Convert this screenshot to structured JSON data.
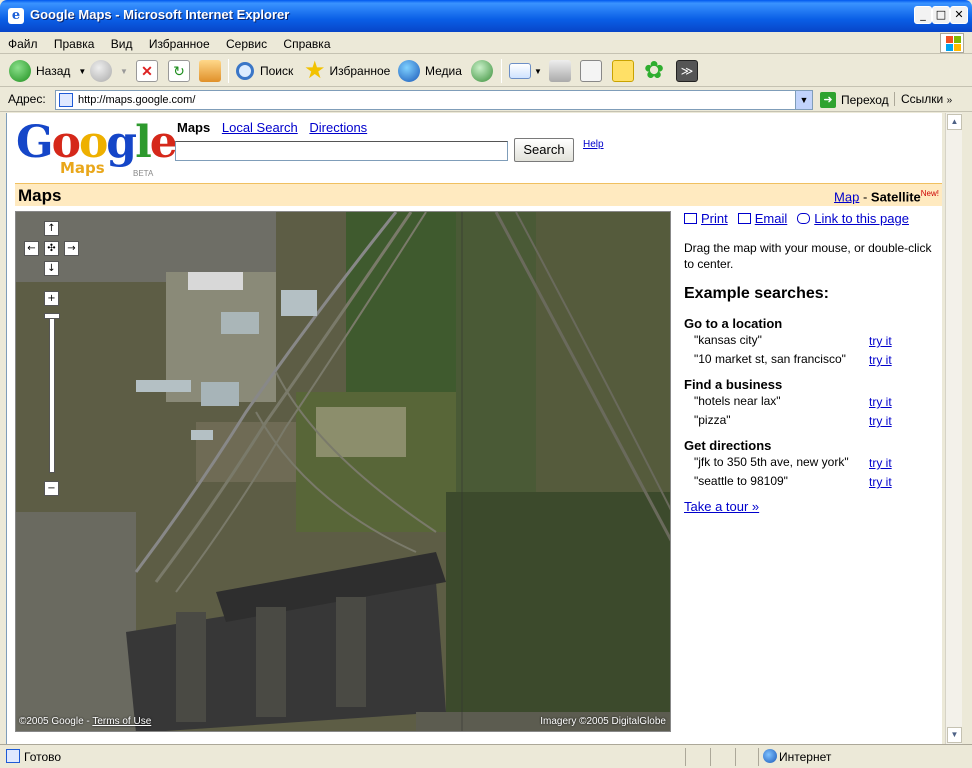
{
  "window": {
    "title": "Google Maps - Microsoft Internet Explorer"
  },
  "menu": [
    "Файл",
    "Правка",
    "Вид",
    "Избранное",
    "Сервис",
    "Справка"
  ],
  "toolbar": {
    "back": "Назад",
    "search": "Поиск",
    "favorites": "Избранное",
    "media": "Медиа"
  },
  "address": {
    "label": "Адрес:",
    "url": "http://maps.google.com/",
    "go": "Переход",
    "links": "Ссылки"
  },
  "google": {
    "logo": "Google",
    "logo_sub": "Maps",
    "logo_beta": "BETA",
    "nav": {
      "maps": "Maps",
      "local": "Local Search",
      "directions": "Directions"
    },
    "search_button": "Search",
    "help": "Help"
  },
  "mapsbar": {
    "title": "Maps",
    "map": "Map",
    "dash": " - ",
    "satellite": "Satellite",
    "new": "New!"
  },
  "map": {
    "copyright": "©2005 Google - ",
    "terms": "Terms of Use",
    "imagery": "Imagery ©2005 DigitalGlobe"
  },
  "panel": {
    "print": "Print",
    "email": "Email",
    "link": "Link to this page",
    "drag": "Drag the map with your mouse, or double-click to center.",
    "examples_heading": "Example searches:",
    "sections": [
      {
        "title": "Go to a location",
        "items": [
          {
            "q": "\"kansas city\"",
            "a": "try it"
          },
          {
            "q": "\"10 market st, san francisco\"",
            "a": "try it"
          }
        ]
      },
      {
        "title": "Find a business",
        "items": [
          {
            "q": "\"hotels near lax\"",
            "a": "try it"
          },
          {
            "q": "\"pizza\"",
            "a": "try it"
          }
        ]
      },
      {
        "title": "Get directions",
        "items": [
          {
            "q": "\"jfk to 350 5th ave, new york\"",
            "a": "try it"
          },
          {
            "q": "\"seattle to 98109\"",
            "a": "try it"
          }
        ]
      }
    ],
    "tour": "Take a tour »"
  },
  "status": {
    "text": "Готово",
    "zone": "Интернет"
  }
}
